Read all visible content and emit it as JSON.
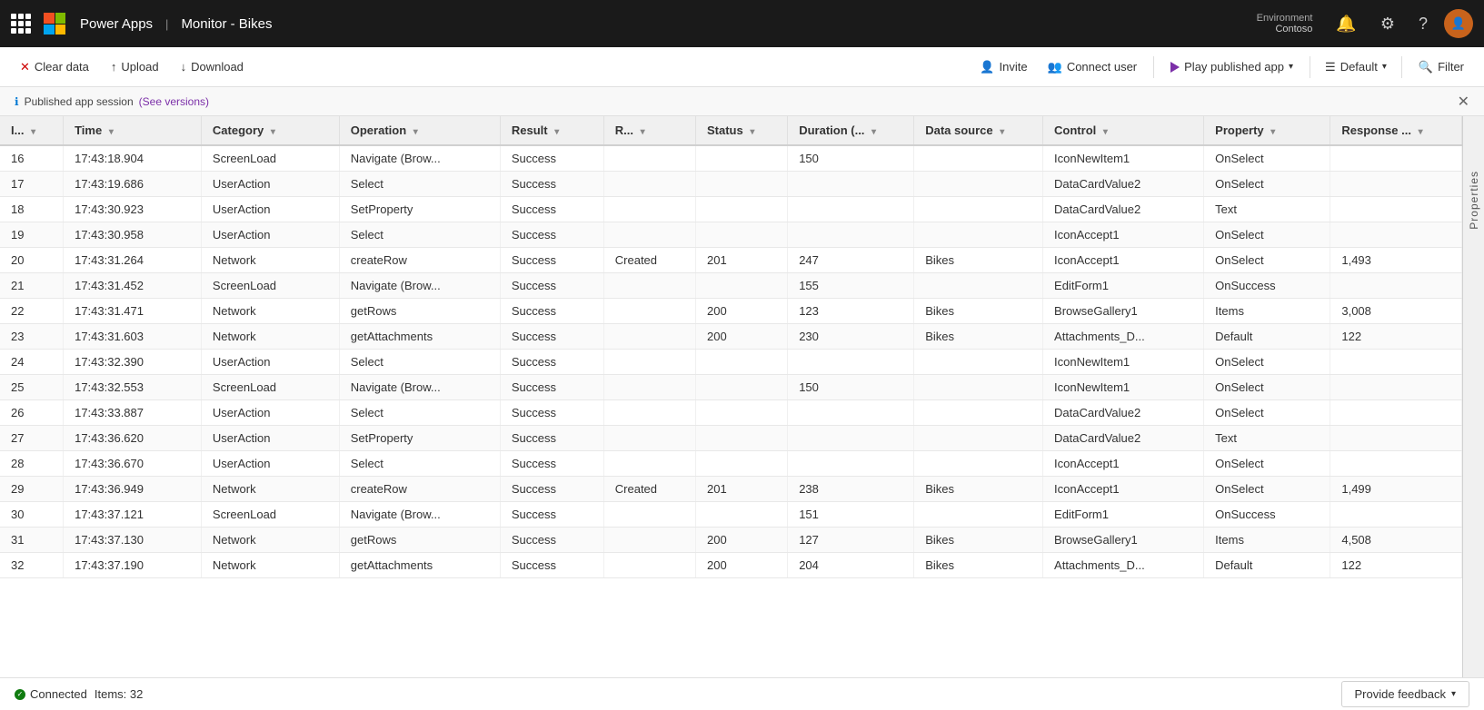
{
  "nav": {
    "app_name": "Power Apps",
    "separator": "|",
    "section": "Monitor - Bikes",
    "environment_label": "Environment",
    "environment_name": "Contoso"
  },
  "toolbar": {
    "clear_data": "Clear data",
    "upload": "Upload",
    "download": "Download",
    "invite": "Invite",
    "connect_user": "Connect user",
    "play_published_app": "Play published app",
    "default": "Default",
    "filter": "Filter"
  },
  "info_bar": {
    "text": "Published app session",
    "link_text": "(See versions)"
  },
  "table": {
    "columns": [
      {
        "key": "id",
        "label": "I..."
      },
      {
        "key": "time",
        "label": "Time"
      },
      {
        "key": "category",
        "label": "Category"
      },
      {
        "key": "operation",
        "label": "Operation"
      },
      {
        "key": "result",
        "label": "Result"
      },
      {
        "key": "r",
        "label": "R..."
      },
      {
        "key": "status",
        "label": "Status"
      },
      {
        "key": "duration",
        "label": "Duration (..."
      },
      {
        "key": "datasource",
        "label": "Data source"
      },
      {
        "key": "control",
        "label": "Control"
      },
      {
        "key": "property",
        "label": "Property"
      },
      {
        "key": "response",
        "label": "Response ..."
      }
    ],
    "rows": [
      {
        "id": "16",
        "time": "17:43:18.904",
        "category": "ScreenLoad",
        "operation": "Navigate (Brow...",
        "result": "Success",
        "r": "",
        "status": "",
        "duration": "150",
        "datasource": "",
        "control": "IconNewItem1",
        "property": "OnSelect",
        "response": ""
      },
      {
        "id": "17",
        "time": "17:43:19.686",
        "category": "UserAction",
        "operation": "Select",
        "result": "Success",
        "r": "",
        "status": "",
        "duration": "",
        "datasource": "",
        "control": "DataCardValue2",
        "property": "OnSelect",
        "response": ""
      },
      {
        "id": "18",
        "time": "17:43:30.923",
        "category": "UserAction",
        "operation": "SetProperty",
        "result": "Success",
        "r": "",
        "status": "",
        "duration": "",
        "datasource": "",
        "control": "DataCardValue2",
        "property": "Text",
        "response": ""
      },
      {
        "id": "19",
        "time": "17:43:30.958",
        "category": "UserAction",
        "operation": "Select",
        "result": "Success",
        "r": "",
        "status": "",
        "duration": "",
        "datasource": "",
        "control": "IconAccept1",
        "property": "OnSelect",
        "response": ""
      },
      {
        "id": "20",
        "time": "17:43:31.264",
        "category": "Network",
        "operation": "createRow",
        "result": "Success",
        "r": "Created",
        "status": "201",
        "duration": "247",
        "datasource": "Bikes",
        "control": "IconAccept1",
        "property": "OnSelect",
        "response": "1,493"
      },
      {
        "id": "21",
        "time": "17:43:31.452",
        "category": "ScreenLoad",
        "operation": "Navigate (Brow...",
        "result": "Success",
        "r": "",
        "status": "",
        "duration": "155",
        "datasource": "",
        "control": "EditForm1",
        "property": "OnSuccess",
        "response": ""
      },
      {
        "id": "22",
        "time": "17:43:31.471",
        "category": "Network",
        "operation": "getRows",
        "result": "Success",
        "r": "",
        "status": "200",
        "duration": "123",
        "datasource": "Bikes",
        "control": "BrowseGallery1",
        "property": "Items",
        "response": "3,008"
      },
      {
        "id": "23",
        "time": "17:43:31.603",
        "category": "Network",
        "operation": "getAttachments",
        "result": "Success",
        "r": "",
        "status": "200",
        "duration": "230",
        "datasource": "Bikes",
        "control": "Attachments_D...",
        "property": "Default",
        "response": "122"
      },
      {
        "id": "24",
        "time": "17:43:32.390",
        "category": "UserAction",
        "operation": "Select",
        "result": "Success",
        "r": "",
        "status": "",
        "duration": "",
        "datasource": "",
        "control": "IconNewItem1",
        "property": "OnSelect",
        "response": ""
      },
      {
        "id": "25",
        "time": "17:43:32.553",
        "category": "ScreenLoad",
        "operation": "Navigate (Brow...",
        "result": "Success",
        "r": "",
        "status": "",
        "duration": "150",
        "datasource": "",
        "control": "IconNewItem1",
        "property": "OnSelect",
        "response": ""
      },
      {
        "id": "26",
        "time": "17:43:33.887",
        "category": "UserAction",
        "operation": "Select",
        "result": "Success",
        "r": "",
        "status": "",
        "duration": "",
        "datasource": "",
        "control": "DataCardValue2",
        "property": "OnSelect",
        "response": ""
      },
      {
        "id": "27",
        "time": "17:43:36.620",
        "category": "UserAction",
        "operation": "SetProperty",
        "result": "Success",
        "r": "",
        "status": "",
        "duration": "",
        "datasource": "",
        "control": "DataCardValue2",
        "property": "Text",
        "response": ""
      },
      {
        "id": "28",
        "time": "17:43:36.670",
        "category": "UserAction",
        "operation": "Select",
        "result": "Success",
        "r": "",
        "status": "",
        "duration": "",
        "datasource": "",
        "control": "IconAccept1",
        "property": "OnSelect",
        "response": ""
      },
      {
        "id": "29",
        "time": "17:43:36.949",
        "category": "Network",
        "operation": "createRow",
        "result": "Success",
        "r": "Created",
        "status": "201",
        "duration": "238",
        "datasource": "Bikes",
        "control": "IconAccept1",
        "property": "OnSelect",
        "response": "1,499"
      },
      {
        "id": "30",
        "time": "17:43:37.121",
        "category": "ScreenLoad",
        "operation": "Navigate (Brow...",
        "result": "Success",
        "r": "",
        "status": "",
        "duration": "151",
        "datasource": "",
        "control": "EditForm1",
        "property": "OnSuccess",
        "response": ""
      },
      {
        "id": "31",
        "time": "17:43:37.130",
        "category": "Network",
        "operation": "getRows",
        "result": "Success",
        "r": "",
        "status": "200",
        "duration": "127",
        "datasource": "Bikes",
        "control": "BrowseGallery1",
        "property": "Items",
        "response": "4,508"
      },
      {
        "id": "32",
        "time": "17:43:37.190",
        "category": "Network",
        "operation": "getAttachments",
        "result": "Success",
        "r": "",
        "status": "200",
        "duration": "204",
        "datasource": "Bikes",
        "control": "Attachments_D...",
        "property": "Default",
        "response": "122"
      }
    ]
  },
  "right_panel": {
    "label": "Properties"
  },
  "status_bar": {
    "connected_label": "Connected",
    "items_label": "Items: 32",
    "feedback_label": "Provide feedback"
  }
}
